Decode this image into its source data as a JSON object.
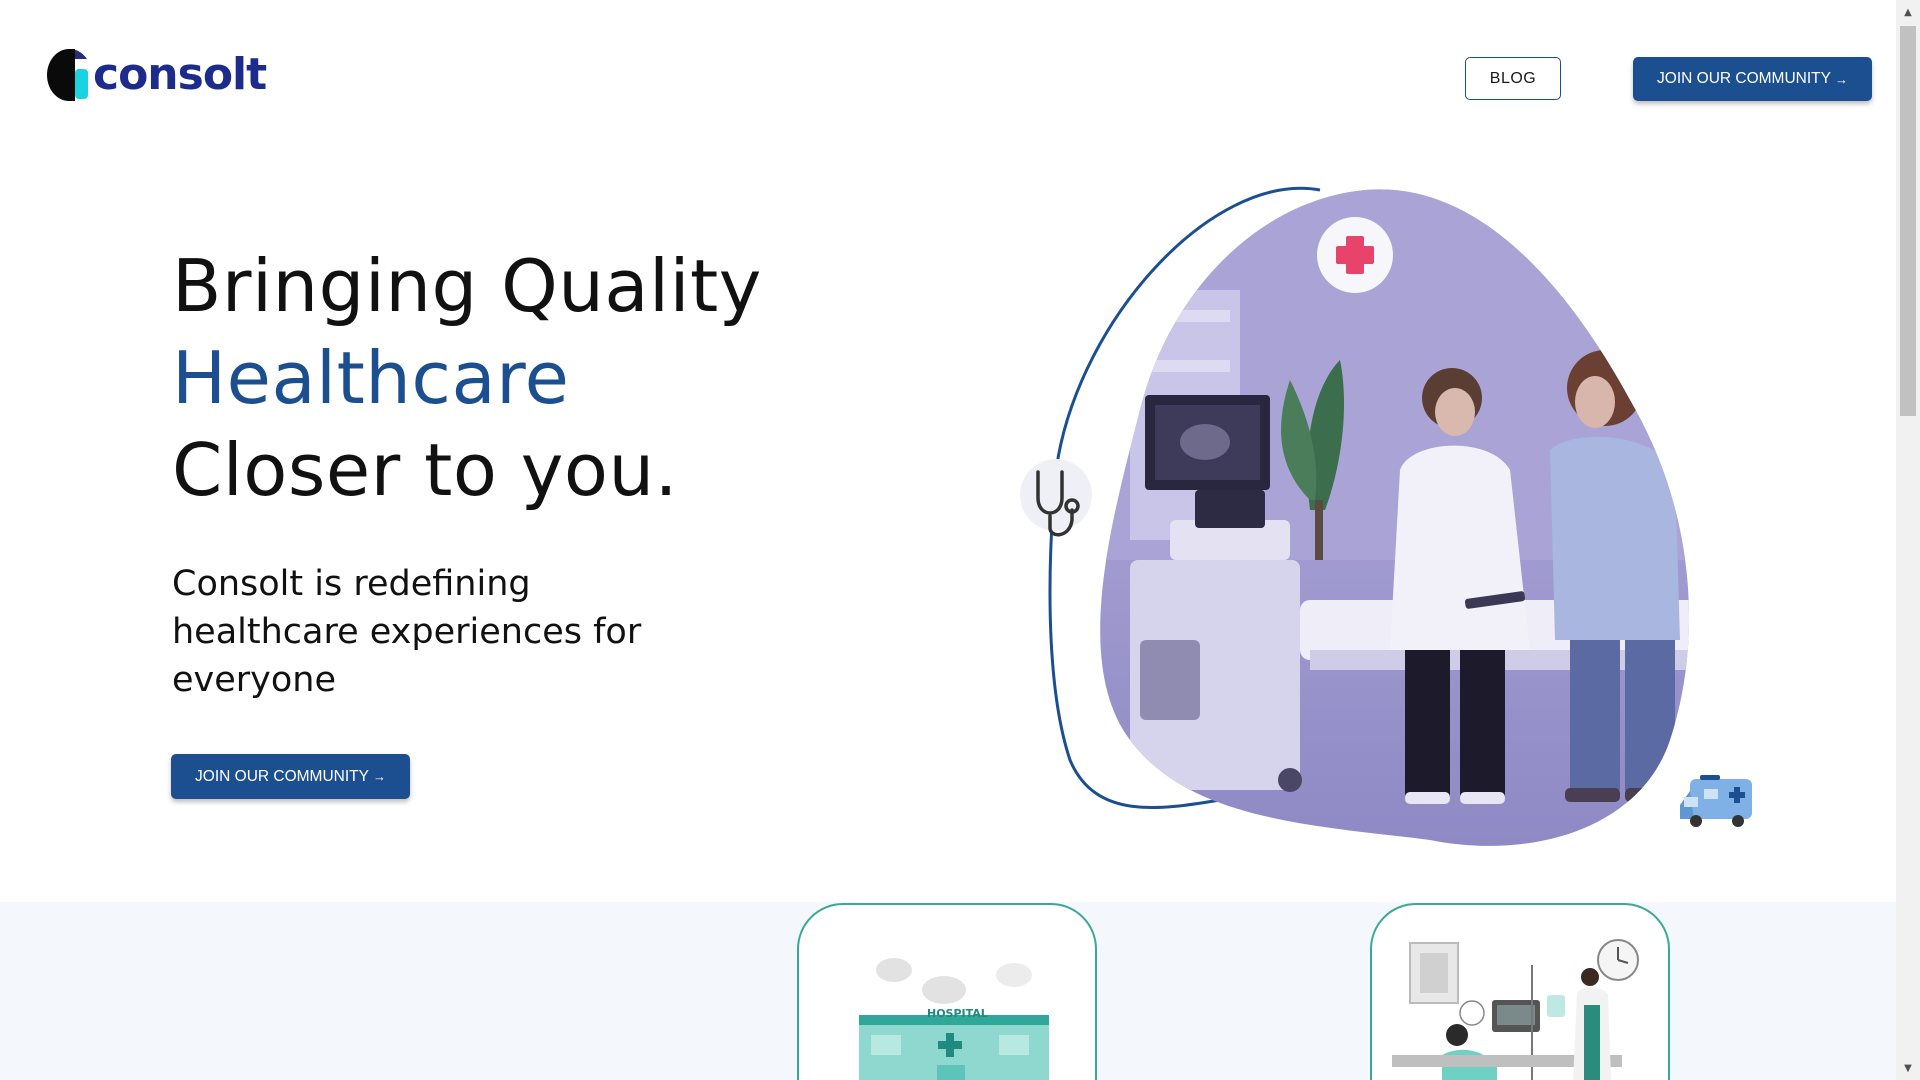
{
  "header": {
    "logo_text": "consolt",
    "blog_label": "BLOG",
    "join_label": "JOIN OUR COMMUNITY",
    "arrow": "→"
  },
  "hero": {
    "title_line1": "Bringing Quality",
    "title_line2": "Healthcare",
    "title_line3": "Closer to you.",
    "subtitle": "Consolt is redefining healthcare experiences for everyone",
    "cta_label": "JOIN OUR COMMUNITY",
    "arrow": "→"
  },
  "cards": [
    {
      "illustration": "hospital-building-illustration",
      "sign": "HOSPITAL"
    },
    {
      "illustration": "patient-bed-doctor-illustration"
    }
  ],
  "colors": {
    "brand_blue": "#1b4f8f",
    "logo_navy": "#1c2b8c",
    "logo_cyan": "#19d3e0",
    "card_border": "#3ba79a",
    "blob_purple": "#a59fd0",
    "cross_red": "#e8436a"
  },
  "icons": [
    "plus-cross-icon",
    "stethoscope-icon",
    "ambulance-icon",
    "chevron-up-icon",
    "chevron-down-icon"
  ]
}
